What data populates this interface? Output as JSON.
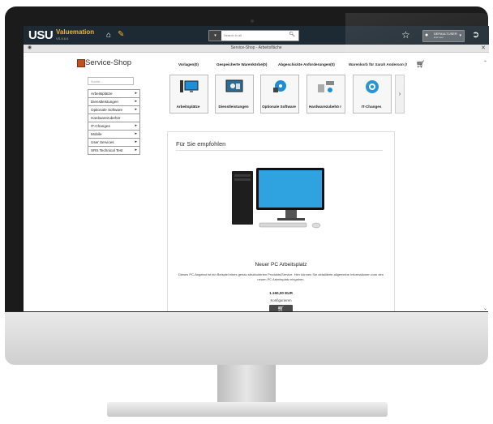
{
  "topbar": {
    "logo": "USU",
    "brand": "Valuemation",
    "brand_sub": "VS.5.6.6",
    "search_placeholder": "Search in all",
    "user_name": "DEFAULTUSER",
    "user_role": "End user"
  },
  "titlebar": {
    "title": "Service-Shop - Arbeitsfläche"
  },
  "shop": {
    "title": "Service-Shop",
    "nav": [
      "Vorlagen(0)",
      "Gespeicherte Warenkörbe(0)",
      "Abgeschickte Anforderungen(0)",
      "Warenkorb für"
    ],
    "cart_owner": "Sarah Anderson (I",
    "search_placeholder": "Suche...",
    "categories": [
      {
        "label": "Arbeitsplätze",
        "arrow": true
      },
      {
        "label": "Dienstleistungen",
        "arrow": true
      },
      {
        "label": "Optionale Software",
        "arrow": true
      },
      {
        "label": "Hardwarezubehör",
        "arrow": false
      },
      {
        "label": "IT-Changes",
        "arrow": true
      },
      {
        "label": "Mobile",
        "arrow": true
      },
      {
        "label": "User Services",
        "arrow": true
      },
      {
        "label": "SRS Technical Test",
        "arrow": true
      }
    ],
    "tiles": [
      {
        "label": "Arbeitsplätze",
        "icon": "workstation-icon"
      },
      {
        "label": "Dienstleistungen",
        "icon": "services-icon"
      },
      {
        "label": "Optionale Software",
        "icon": "software-icon"
      },
      {
        "label": "Hardwarezubehö r",
        "icon": "hardware-icon"
      },
      {
        "label": "IT-Changes",
        "icon": "it-changes-icon"
      }
    ]
  },
  "recommended": {
    "title": "Für Sie empfohlen",
    "product_name": "Neuer PC Arbeitsplatz",
    "description": "Dieses PC-Angebot ist ein Beispiel eines genau strukturierten Produkts/Service. Hier können Sie detaillierte allgemeine Informationen zum den neuen PC Arbeitsplatz eingeben.",
    "price": "1.160,00 EUR",
    "configure": "Konfigurieren"
  },
  "colors": {
    "topbar": "#1e2a33",
    "accent": "#f2b233",
    "tile_blue": "#1e8fd6"
  }
}
